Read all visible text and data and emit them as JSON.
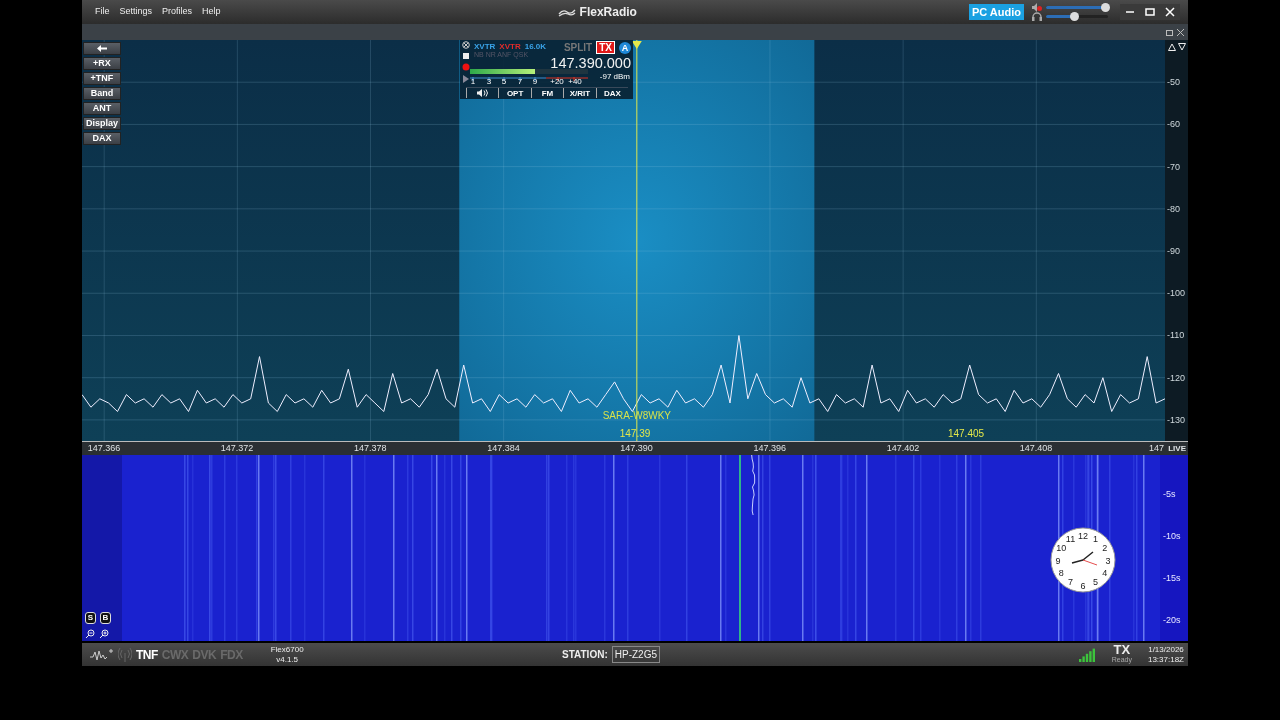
{
  "menu": [
    "File",
    "Settings",
    "Profiles",
    "Help"
  ],
  "logo": "FlexRadio",
  "pc_audio": "PC Audio",
  "speaker": {
    "muted": true,
    "level": 0.95
  },
  "headphones": {
    "level": 0.45
  },
  "side_buttons": [
    "+RX",
    "+TNF",
    "Band",
    "ANT",
    "Display",
    "DAX"
  ],
  "slice": {
    "xvtr_rx": "XVTR",
    "xvtr_tx": "XVTR",
    "bandwidth": "16.0K",
    "dsp": "NB NR ANF QSK",
    "split": "SPLIT",
    "tx": "TX",
    "letter": "A",
    "frequency": "147.390.000",
    "level": 0.55,
    "scale": [
      "1",
      "3",
      "5",
      "7",
      "9",
      "+20",
      "+40"
    ],
    "dbm": "-97 dBm",
    "buttons": [
      "OPT",
      "FM",
      "X/RIT",
      "DAX"
    ]
  },
  "spectrum": {
    "chart_data": {
      "type": "line",
      "xlim": [
        147.365,
        147.4138
      ],
      "ylim": [
        -135,
        -40
      ],
      "grid": true,
      "bands": [
        {
          "axis": "x",
          "from": 147.382,
          "to": 147.398
        }
      ],
      "ref_lines": [
        {
          "axis": "x",
          "value": 147.39
        }
      ],
      "yticks": [
        -50,
        -60,
        -70,
        -80,
        -90,
        -100,
        -110,
        -120,
        -130
      ],
      "xticks": [
        {
          "value": 147.366,
          "label": "147.366"
        },
        {
          "value": 147.372,
          "label": "147.372"
        },
        {
          "value": 147.378,
          "label": "147.378"
        },
        {
          "value": 147.384,
          "label": "147.384"
        },
        {
          "value": 147.39,
          "label": "147.390"
        },
        {
          "value": 147.396,
          "label": "147.396"
        },
        {
          "value": 147.402,
          "label": "147.402"
        },
        {
          "value": 147.408,
          "label": "147.408"
        }
      ],
      "x": [
        147.365,
        147.3654,
        147.3658,
        147.3662,
        147.3666,
        147.367,
        147.3674,
        147.3678,
        147.3682,
        147.3686,
        147.369,
        147.3694,
        147.3698,
        147.3702,
        147.3706,
        147.371,
        147.3714,
        147.3718,
        147.3722,
        147.3726,
        147.373,
        147.3734,
        147.3738,
        147.3742,
        147.3746,
        147.375,
        147.3754,
        147.3758,
        147.3762,
        147.3766,
        147.377,
        147.3774,
        147.3778,
        147.3782,
        147.3786,
        147.379,
        147.3794,
        147.3798,
        147.3802,
        147.3806,
        147.381,
        147.3814,
        147.3818,
        147.3822,
        147.3826,
        147.383,
        147.3834,
        147.3838,
        147.3842,
        147.3846,
        147.385,
        147.3854,
        147.3858,
        147.3862,
        147.3866,
        147.387,
        147.3874,
        147.3878,
        147.3882,
        147.3886,
        147.389,
        147.3894,
        147.3898,
        147.3902,
        147.3906,
        147.391,
        147.3914,
        147.3918,
        147.3922,
        147.3926,
        147.393,
        147.3934,
        147.3938,
        147.3942,
        147.3946,
        147.395,
        147.3954,
        147.3958,
        147.3962,
        147.3966,
        147.397,
        147.3974,
        147.3978,
        147.3982,
        147.3986,
        147.399,
        147.3994,
        147.3998,
        147.4002,
        147.4006,
        147.401,
        147.4014,
        147.4018,
        147.4022,
        147.4026,
        147.403,
        147.4034,
        147.4038,
        147.4042,
        147.4046,
        147.405,
        147.4054,
        147.4058,
        147.4062,
        147.4066,
        147.407,
        147.4074,
        147.4078,
        147.4082,
        147.4086,
        147.409,
        147.4094,
        147.4098,
        147.4102,
        147.4106,
        147.411,
        147.4114,
        147.4118,
        147.4122,
        147.4126,
        147.413,
        147.4134,
        147.4138
      ],
      "values": [
        -124,
        -127,
        -125,
        -126,
        -128,
        -124,
        -126,
        -125,
        -127,
        -124,
        -126,
        -125,
        -128,
        -123,
        -126,
        -125,
        -127,
        -124,
        -126,
        -125,
        -115,
        -126,
        -128,
        -124,
        -126,
        -125,
        -127,
        -123,
        -126,
        -125,
        -118,
        -127,
        -124,
        -126,
        -128,
        -119,
        -126,
        -125,
        -127,
        -124,
        -118,
        -125,
        -127,
        -117,
        -126,
        -125,
        -128,
        -124,
        -126,
        -125,
        -127,
        -124,
        -126,
        -125,
        -128,
        -123,
        -126,
        -125,
        -127,
        -124,
        -121,
        -125,
        -128,
        -124,
        -126,
        -125,
        -127,
        -123,
        -126,
        -125,
        -127,
        -124,
        -117,
        -126,
        -110,
        -125,
        -119,
        -124,
        -126,
        -125,
        -127,
        -120,
        -126,
        -125,
        -128,
        -124,
        -126,
        -125,
        -127,
        -117,
        -126,
        -125,
        -128,
        -123,
        -126,
        -125,
        -127,
        -124,
        -126,
        -125,
        -117,
        -124,
        -126,
        -125,
        -128,
        -123,
        -126,
        -125,
        -127,
        -124,
        -119,
        -125,
        -127,
        -124,
        -126,
        -120,
        -128,
        -124,
        -126,
        -125,
        -115,
        -126,
        -125
      ]
    }
  },
  "spot": "SARA-W8WKY",
  "markers": [
    "147.39",
    "147.405"
  ],
  "axis_cut_label": "147",
  "live": "LIVE",
  "time_scale": [
    "-5s",
    "-10s",
    "-15s",
    "-20s"
  ],
  "waterfall_buttons": [
    "S",
    "B"
  ],
  "clock_numbers": [
    "11",
    "12",
    "1",
    "10",
    "2",
    "9",
    "3",
    "8",
    "4",
    "7",
    "5",
    "6"
  ],
  "status": {
    "modes": [
      {
        "label": "TNF",
        "on": true
      },
      {
        "label": "CWX",
        "on": false
      },
      {
        "label": "DVK",
        "on": false
      },
      {
        "label": "FDX",
        "on": false
      }
    ],
    "model": "Flex6700",
    "version": "v4.1.5",
    "station_label": "STATION:",
    "station": "HP-Z2G5",
    "tx": "TX",
    "tx_state": "Ready",
    "date": "1/13/2026",
    "time": "13:37:18Z"
  }
}
